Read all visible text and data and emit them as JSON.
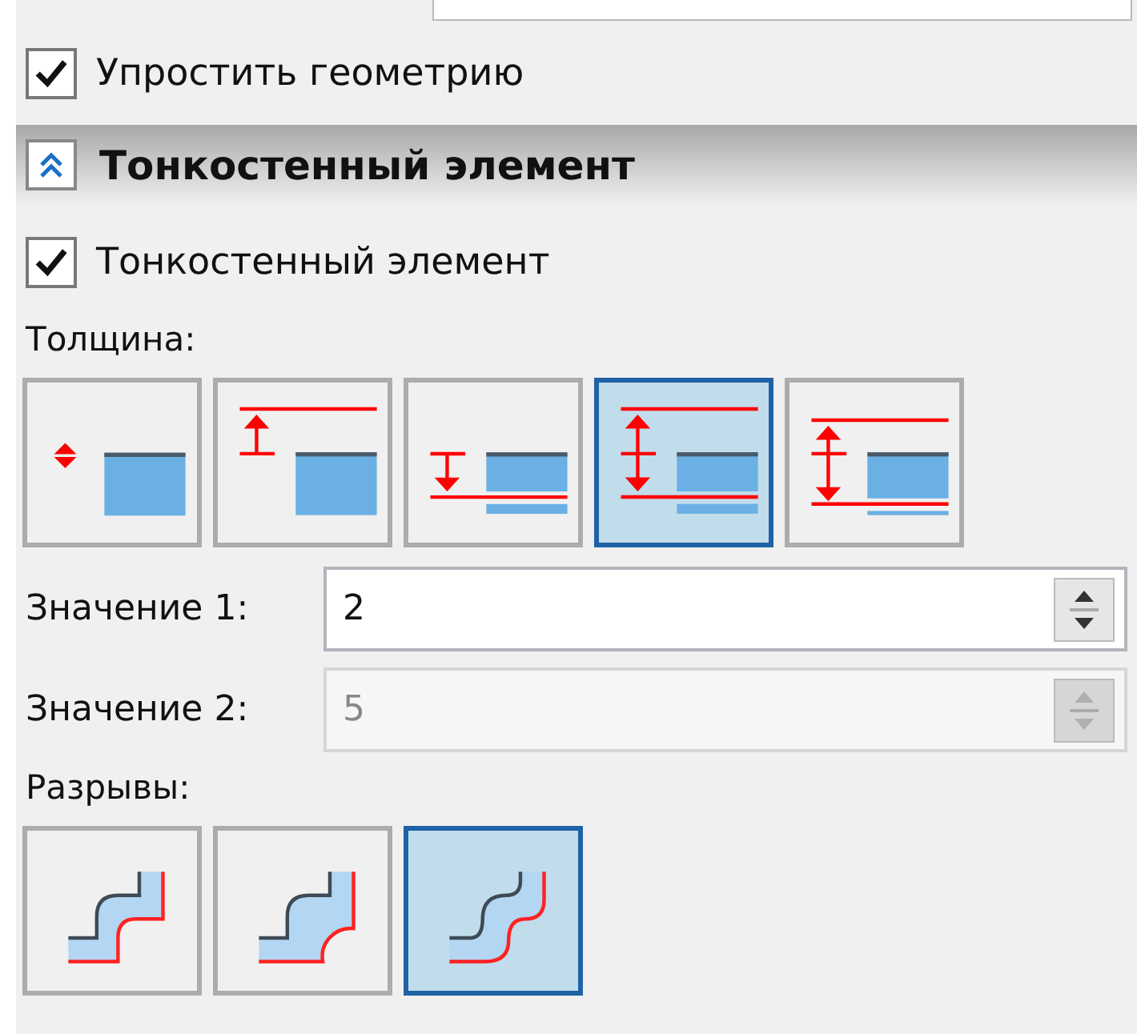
{
  "simplify": {
    "label": "Упростить геометрию",
    "checked": true
  },
  "section": {
    "title": "Тонкостенный элемент",
    "expanded": true
  },
  "thin_wall": {
    "label": "Тонкостенный элемент",
    "checked": true
  },
  "thickness": {
    "label": "Толщина:",
    "buttons": [
      {
        "kind": "symmetric",
        "selected": false
      },
      {
        "kind": "up",
        "selected": false
      },
      {
        "kind": "down",
        "selected": false
      },
      {
        "kind": "both",
        "selected": true
      },
      {
        "kind": "mid",
        "selected": false
      }
    ]
  },
  "fields": [
    {
      "label": "Значение 1:",
      "value": "2",
      "disabled": false
    },
    {
      "label": "Значение 2:",
      "value": "5",
      "disabled": true
    }
  ],
  "breaks": {
    "label": "Разрывы:",
    "buttons": [
      {
        "kind": "sharp",
        "selected": false
      },
      {
        "kind": "round-inner",
        "selected": false
      },
      {
        "kind": "round",
        "selected": true
      }
    ]
  }
}
